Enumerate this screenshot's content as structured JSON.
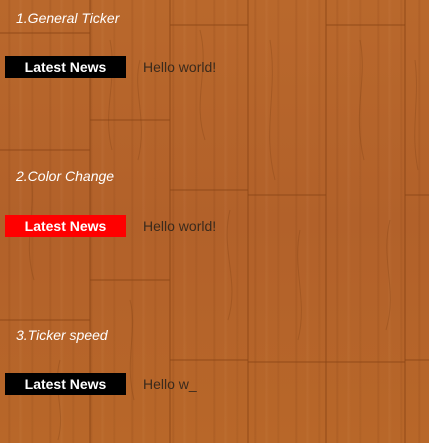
{
  "sections": [
    {
      "heading": "1.General Ticker",
      "label": "Latest News",
      "ticker_text": "Hello world!",
      "label_color": "#000000"
    },
    {
      "heading": "2.Color Change",
      "label": "Latest News",
      "ticker_text": "Hello world!",
      "label_color": "#ff0000"
    },
    {
      "heading": "3.Ticker speed",
      "label": "Latest News",
      "ticker_text": "Hello w_",
      "label_color": "#000000"
    }
  ]
}
